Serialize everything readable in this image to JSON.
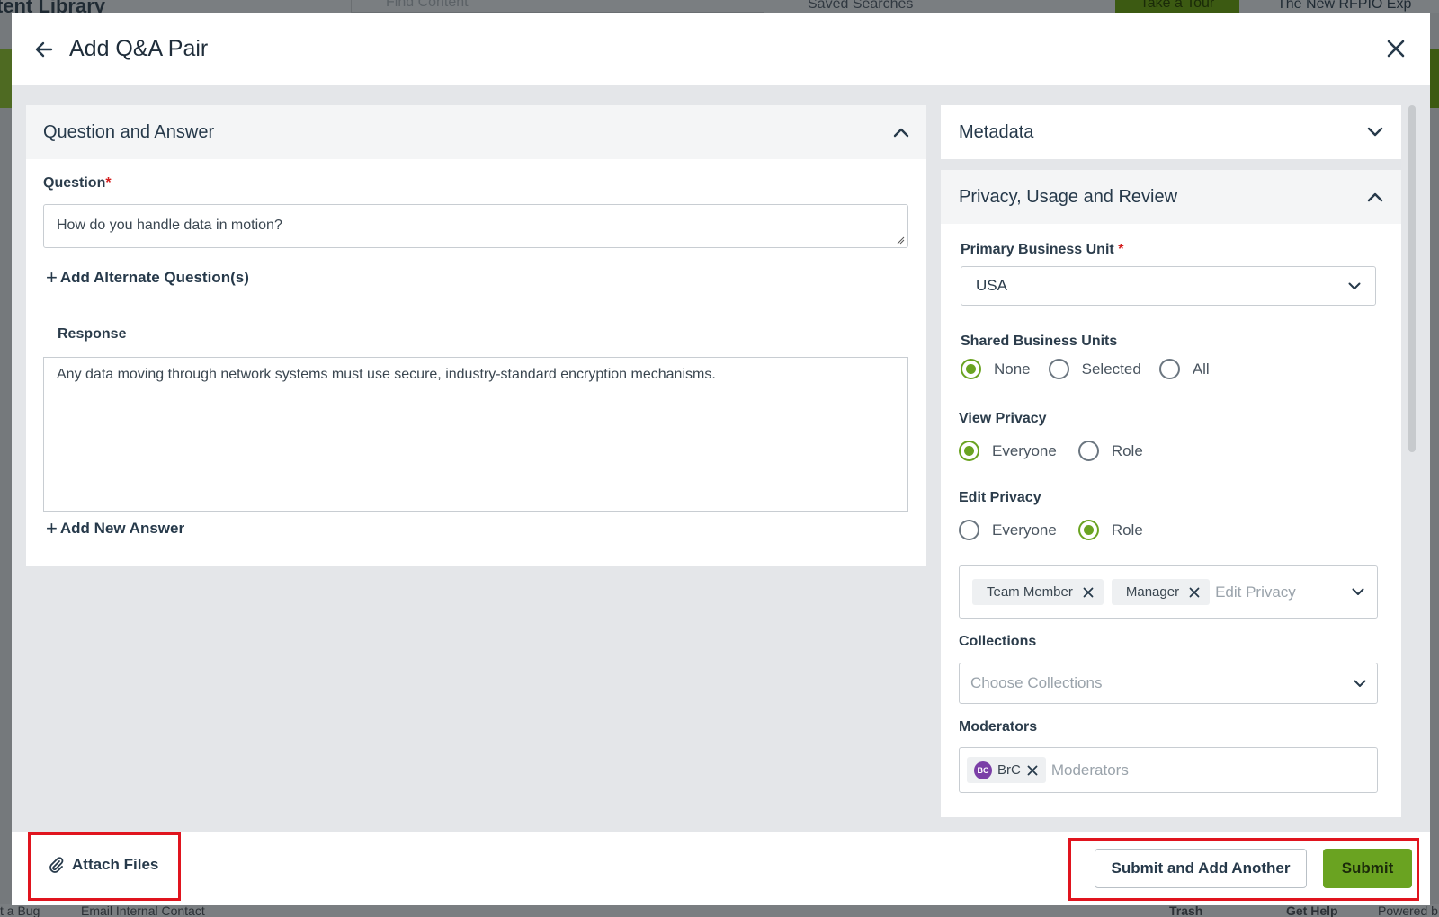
{
  "background": {
    "title": "tent Library",
    "search_placeholder": "Find Content",
    "saved_searches": "Saved Searches",
    "tour_button": "Take a Tour",
    "new_banner": "The New RFPIO Exp",
    "footer_left": "t a Bug",
    "footer_email": "Email Internal Contact",
    "footer_trash": "Trash",
    "footer_help": "Get Help",
    "footer_powered": "Powered b"
  },
  "modal": {
    "title": "Add Q&A Pair"
  },
  "qa_panel": {
    "title": "Question and Answer",
    "question_label": "Question",
    "required_mark": "*",
    "question_value": "How do you handle data in motion?",
    "add_alternate": "Add Alternate Question(s)",
    "response_label": "Response",
    "response_value": "Any data moving through network systems must use secure, industry-standard encryption mechanisms.",
    "add_answer": "Add New Answer"
  },
  "metadata": {
    "title": "Metadata"
  },
  "privacy": {
    "title": "Privacy, Usage and Review",
    "primary_bu_label": "Primary Business Unit",
    "required_mark": "*",
    "primary_bu_value": "USA",
    "shared_bu_label": "Shared Business Units",
    "shared_bu_options": [
      "None",
      "Selected",
      "All"
    ],
    "shared_bu_selected": "None",
    "view_privacy_label": "View Privacy",
    "view_privacy_options": [
      "Everyone",
      "Role"
    ],
    "view_privacy_selected": "Everyone",
    "edit_privacy_label": "Edit Privacy",
    "edit_privacy_options": [
      "Everyone",
      "Role"
    ],
    "edit_privacy_selected": "Role",
    "edit_privacy_tags": [
      "Team Member",
      "Manager"
    ],
    "edit_privacy_placeholder": "Edit Privacy",
    "collections_label": "Collections",
    "collections_placeholder": "Choose Collections",
    "moderators_label": "Moderators",
    "moderator_initials": "BC",
    "moderator_tag": "BrC",
    "moderators_placeholder": "Moderators"
  },
  "footer": {
    "attach_files": "Attach Files",
    "submit_add_another": "Submit and Add Another",
    "submit": "Submit"
  },
  "colors": {
    "accent": "#6aa321",
    "highlight": "#e0141e",
    "required": "#d42020"
  }
}
